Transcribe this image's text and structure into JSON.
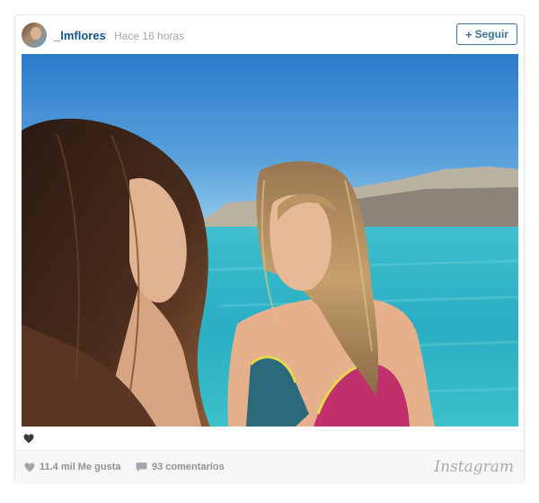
{
  "post": {
    "username": "_lmflores",
    "separator": "•",
    "time": "Hace 16 horas",
    "follow_label": "Seguir",
    "follow_plus": "+",
    "likes": "11.4 mil Me gusta",
    "comments": "93 comentarios",
    "brand": "Instagram"
  },
  "colors": {
    "link": "#125688",
    "follow": "#3f729b",
    "muted": "#8f9194"
  },
  "icons": {
    "like": "heart-icon",
    "comment": "speech-bubble-icon",
    "liked_indicator": "heart-icon"
  }
}
